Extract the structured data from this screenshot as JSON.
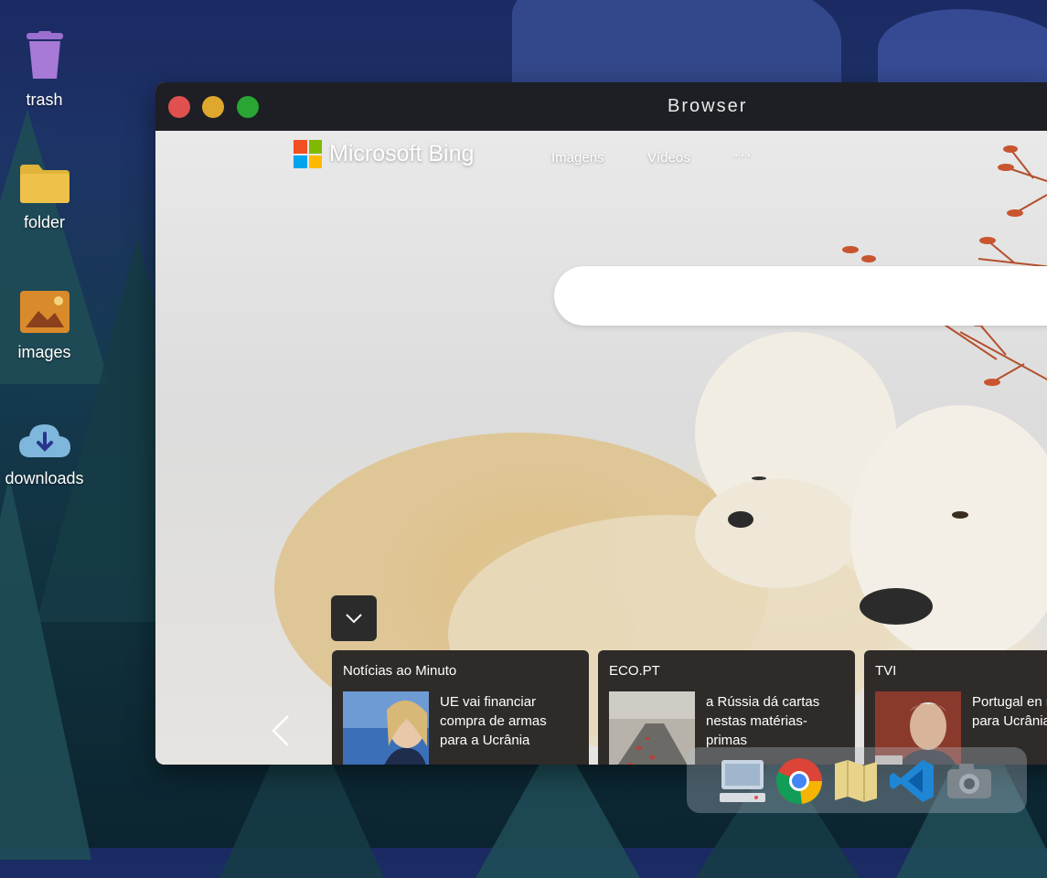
{
  "desktop": {
    "icons": [
      {
        "label": "trash",
        "icon": "trash-icon"
      },
      {
        "label": "folder",
        "icon": "folder-icon"
      },
      {
        "label": "images",
        "icon": "images-icon"
      },
      {
        "label": "downloads",
        "icon": "download-cloud-icon"
      }
    ]
  },
  "window": {
    "title": "Browser",
    "controls": [
      "close",
      "minimize",
      "maximize"
    ]
  },
  "bing": {
    "logo_text": "Microsoft Bing",
    "nav": [
      "Imagens",
      "Vídeos",
      "···"
    ],
    "search_placeholder": ""
  },
  "news_cards": [
    {
      "source": "Notícias ao Minuto",
      "headline": "UE vai financiar compra de armas para a Ucrânia"
    },
    {
      "source": "ECO.PT",
      "headline": "a Rússia dá cartas nestas matérias-primas"
    },
    {
      "source": "TVI",
      "headline": "Portugal en militar para Ucrânia"
    }
  ],
  "dock": {
    "items": [
      "computer-icon",
      "chrome-icon",
      "maps-icon",
      "vscode-icon",
      "camera-icon"
    ]
  },
  "colors": {
    "close": "#e0504f",
    "minimize": "#dea72e",
    "maximize": "#2aa534",
    "ms_red": "#f25022",
    "ms_green": "#7fba00",
    "ms_blue": "#00a4ef",
    "ms_yellow": "#ffb900"
  }
}
